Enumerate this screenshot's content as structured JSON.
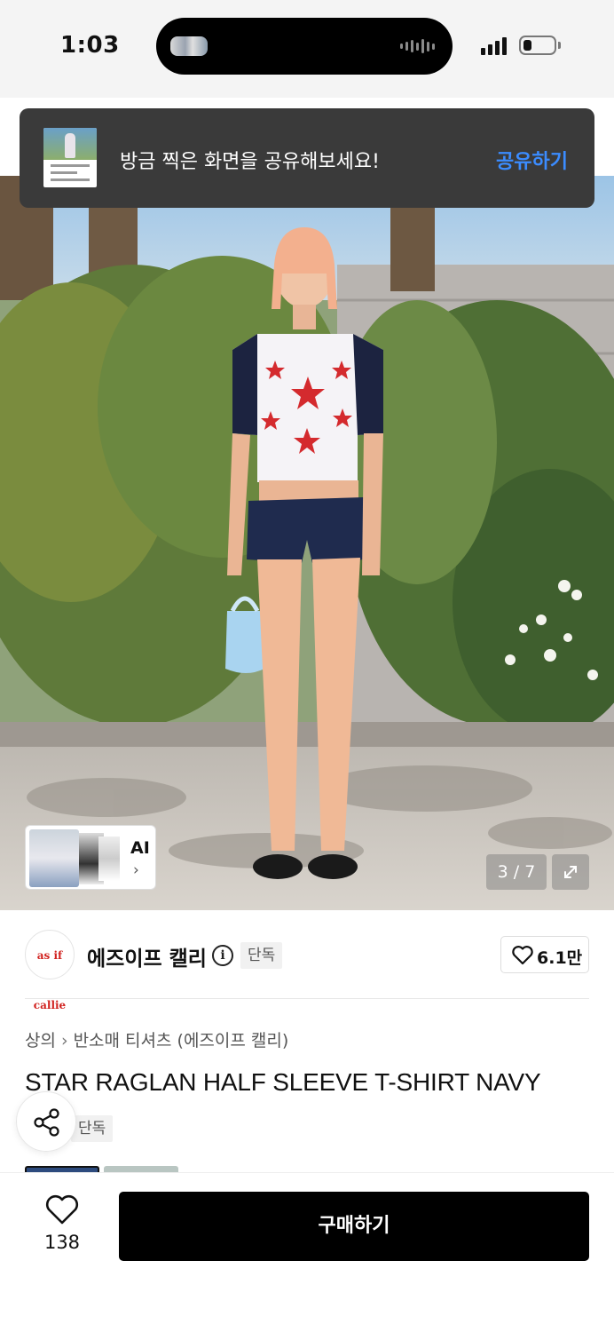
{
  "status_bar": {
    "time": "1:03"
  },
  "toast": {
    "message": "방금 찍은 화면을 공유해보세요!",
    "action": "공유하기"
  },
  "gallery": {
    "ai_label": "AI",
    "ai_chevron": "›",
    "counter": "3 / 7"
  },
  "brand": {
    "logo_text": "as if callie",
    "name": "에즈이프 캘리",
    "info_glyph": "i",
    "exclusive_badge": "단독",
    "like_count": "6.1만"
  },
  "breadcrumb": {
    "category": "상의",
    "separator": "›",
    "subcategory": "반소매 티셔츠 (에즈이프 캘리)"
  },
  "product": {
    "title": "STAR RAGLAN HALF SLEEVE T-SHIRT NAVY",
    "exclusive_badge": "단독"
  },
  "bottom_bar": {
    "wishlist_count": "138",
    "buy_label": "구매하기"
  },
  "colors": {
    "accent_blue": "#3b8cff",
    "toast_bg": "#3a3a3a",
    "buy_bg": "#000000",
    "brand_red": "#d1221f"
  },
  "icons": [
    "info-icon",
    "heart-icon",
    "share-icon",
    "expand-icon",
    "chevron-right-icon"
  ]
}
